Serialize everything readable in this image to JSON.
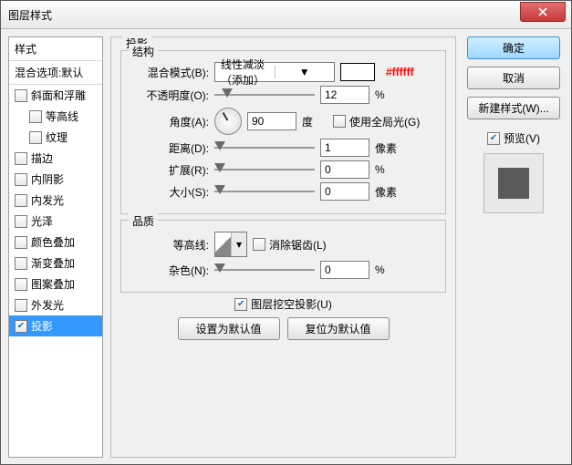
{
  "window": {
    "title": "图层样式"
  },
  "sidebar": {
    "header": "样式",
    "blend": "混合选项:默认",
    "items": [
      {
        "label": "斜面和浮雕",
        "checked": false,
        "indent": false
      },
      {
        "label": "等高线",
        "checked": false,
        "indent": true
      },
      {
        "label": "纹理",
        "checked": false,
        "indent": true
      },
      {
        "label": "描边",
        "checked": false,
        "indent": false
      },
      {
        "label": "内阴影",
        "checked": false,
        "indent": false
      },
      {
        "label": "内发光",
        "checked": false,
        "indent": false
      },
      {
        "label": "光泽",
        "checked": false,
        "indent": false
      },
      {
        "label": "颜色叠加",
        "checked": false,
        "indent": false
      },
      {
        "label": "渐变叠加",
        "checked": false,
        "indent": false
      },
      {
        "label": "图案叠加",
        "checked": false,
        "indent": false
      },
      {
        "label": "外发光",
        "checked": false,
        "indent": false
      },
      {
        "label": "投影",
        "checked": true,
        "indent": false,
        "selected": true
      }
    ]
  },
  "panel": {
    "title": "投影",
    "structure": {
      "legend": "结构",
      "blend_mode_label": "混合模式(B):",
      "blend_mode_value": "线性减淡（添加）",
      "color_hex": "#ffffff",
      "opacity_label": "不透明度(O):",
      "opacity_value": "12",
      "percent": "%",
      "angle_label": "角度(A):",
      "angle_value": "90",
      "angle_unit": "度",
      "global_light_label": "使用全局光(G)",
      "global_light_checked": false,
      "distance_label": "距离(D):",
      "distance_value": "1",
      "px": "像素",
      "spread_label": "扩展(R):",
      "spread_value": "0",
      "size_label": "大小(S):",
      "size_value": "0"
    },
    "quality": {
      "legend": "品质",
      "contour_label": "等高线:",
      "antialias_label": "消除锯齿(L)",
      "antialias_checked": false,
      "noise_label": "杂色(N):",
      "noise_value": "0",
      "percent": "%"
    },
    "knockout_label": "图层挖空投影(U)",
    "knockout_checked": true,
    "btn_defaults": "设置为默认值",
    "btn_reset": "复位为默认值"
  },
  "right": {
    "ok": "确定",
    "cancel": "取消",
    "new_style": "新建样式(W)...",
    "preview_label": "预览(V)",
    "preview_checked": true
  }
}
